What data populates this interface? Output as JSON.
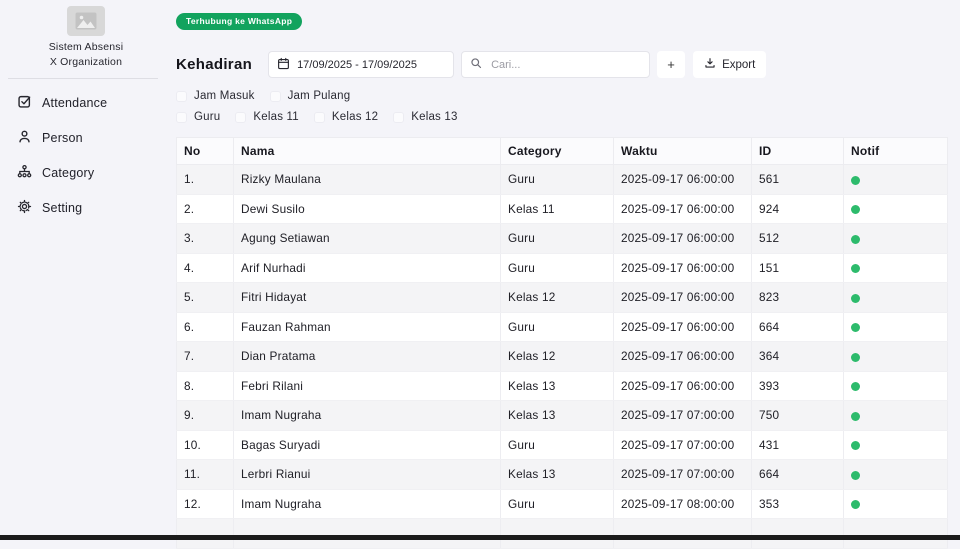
{
  "app": {
    "title_line1": "Sistem Absensi",
    "title_line2": "X Organization"
  },
  "sidebar": {
    "items": [
      {
        "label": "Attendance"
      },
      {
        "label": "Person"
      },
      {
        "label": "Category"
      },
      {
        "label": "Setting"
      }
    ]
  },
  "header": {
    "whatsapp_badge": "Terhubung ke WhatsApp",
    "page_title": "Kehadiran",
    "date_range": "17/09/2025 - 17/09/2025",
    "search_placeholder": "Cari...",
    "add_button": "+",
    "export_button": "Export"
  },
  "filters": {
    "time": [
      "Jam Masuk",
      "Jam Pulang"
    ],
    "category": [
      "Guru",
      "Kelas 11",
      "Kelas 12",
      "Kelas 13"
    ]
  },
  "table": {
    "columns": [
      "No",
      "Nama",
      "Category",
      "Waktu",
      "ID",
      "Notif"
    ],
    "rows": [
      {
        "no": "1.",
        "nama": "Rizky Maulana",
        "category": "Guru",
        "waktu": "2025-09-17 06:00:00",
        "id": "561",
        "notif": "green"
      },
      {
        "no": "2.",
        "nama": "Dewi Susilo",
        "category": "Kelas 11",
        "waktu": "2025-09-17 06:00:00",
        "id": "924",
        "notif": "green"
      },
      {
        "no": "3.",
        "nama": "Agung Setiawan",
        "category": "Guru",
        "waktu": "2025-09-17 06:00:00",
        "id": "512",
        "notif": "green"
      },
      {
        "no": "4.",
        "nama": "Arif Nurhadi",
        "category": "Guru",
        "waktu": "2025-09-17 06:00:00",
        "id": "151",
        "notif": "green"
      },
      {
        "no": "5.",
        "nama": "Fitri Hidayat",
        "category": "Kelas 12",
        "waktu": "2025-09-17 06:00:00",
        "id": "823",
        "notif": "green"
      },
      {
        "no": "6.",
        "nama": "Fauzan Rahman",
        "category": "Guru",
        "waktu": "2025-09-17 06:00:00",
        "id": "664",
        "notif": "green"
      },
      {
        "no": "7.",
        "nama": "Dian Pratama",
        "category": "Kelas 12",
        "waktu": "2025-09-17 06:00:00",
        "id": "364",
        "notif": "green"
      },
      {
        "no": "8.",
        "nama": "Febri Rilani",
        "category": "Kelas 13",
        "waktu": "2025-09-17 06:00:00",
        "id": "393",
        "notif": "green"
      },
      {
        "no": "9.",
        "nama": "Imam Nugraha",
        "category": "Kelas 13",
        "waktu": "2025-09-17 07:00:00",
        "id": "750",
        "notif": "green"
      },
      {
        "no": "10.",
        "nama": "Bagas Suryadi",
        "category": "Guru",
        "waktu": "2025-09-17 07:00:00",
        "id": "431",
        "notif": "green"
      },
      {
        "no": "11.",
        "nama": "Lerbri Rianui",
        "category": "Kelas 13",
        "waktu": "2025-09-17 07:00:00",
        "id": "664",
        "notif": "green"
      },
      {
        "no": "12.",
        "nama": "Imam Nugraha",
        "category": "Guru",
        "waktu": "2025-09-17 08:00:00",
        "id": "353",
        "notif": "green"
      }
    ]
  },
  "colors": {
    "badge_green": "#12a35e",
    "dot_green": "#2dbb6c"
  }
}
